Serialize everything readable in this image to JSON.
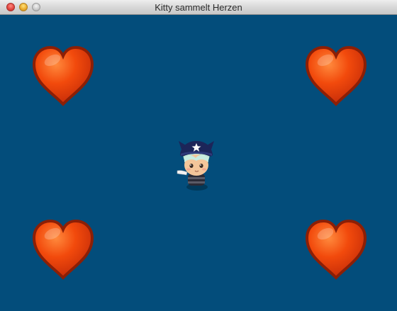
{
  "window": {
    "title": "Kitty sammelt Herzen",
    "background_color": "#034d7b"
  },
  "titlebar": {
    "buttons": [
      "close",
      "minimize",
      "zoom"
    ]
  },
  "game": {
    "player": {
      "name": "kitty",
      "icon": "kitty-character-icon"
    },
    "hearts": [
      {
        "id": "top-left",
        "icon": "heart-icon",
        "color": "#e84a0c"
      },
      {
        "id": "top-right",
        "icon": "heart-icon",
        "color": "#e84a0c"
      },
      {
        "id": "bottom-left",
        "icon": "heart-icon",
        "color": "#e84a0c"
      },
      {
        "id": "bottom-right",
        "icon": "heart-icon",
        "color": "#e84a0c"
      }
    ]
  }
}
